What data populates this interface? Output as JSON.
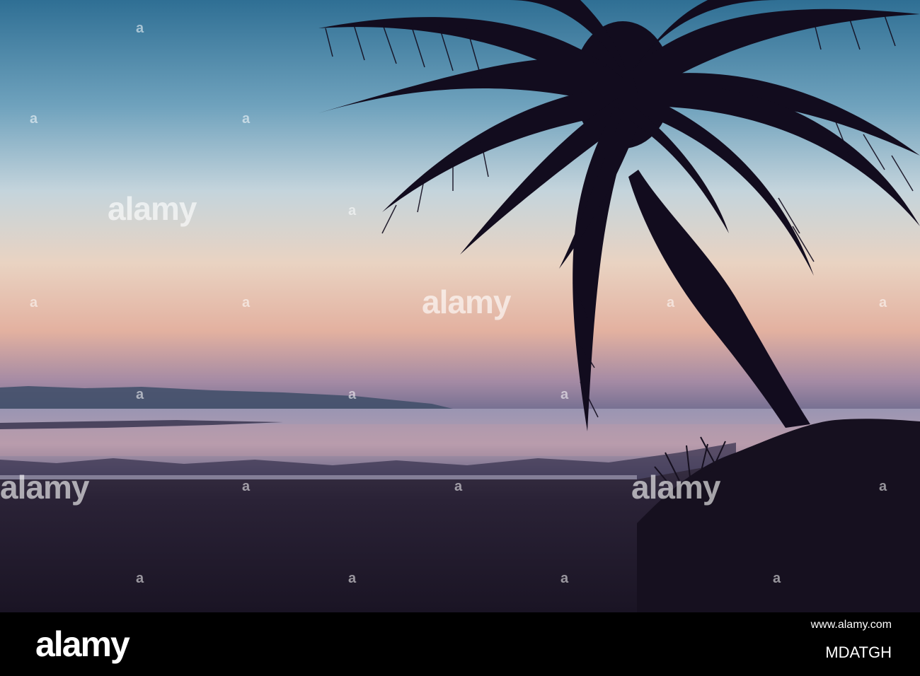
{
  "watermark": {
    "brand": "alamy",
    "mark": "a"
  },
  "footer": {
    "logo": "alamy",
    "url": "www.alamy.com",
    "image_id": "MDATGH"
  },
  "colors": {
    "sky_top": "#3a7ca0",
    "sky_mid": "#c7d6de",
    "sky_horizon": "#e3b7a6",
    "sea": "#8c86a4",
    "sand": "#1f1a2c",
    "silhouette": "#120c1e",
    "footer_bg": "#000000"
  }
}
